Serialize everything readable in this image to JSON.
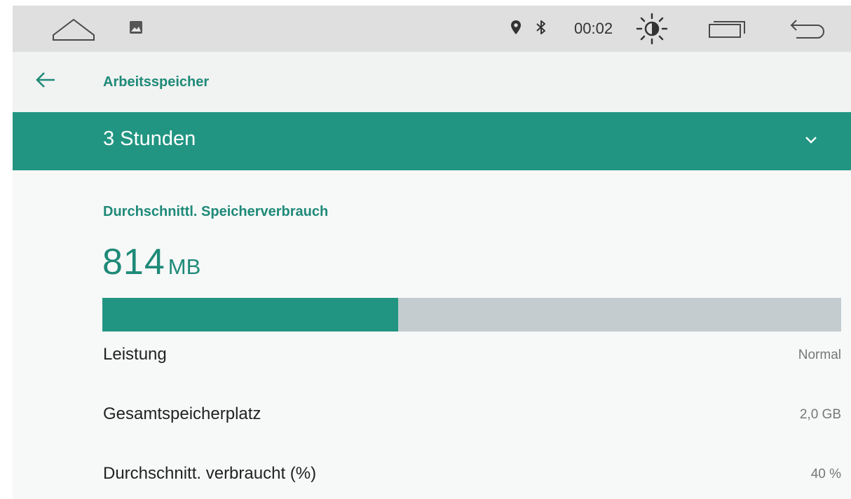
{
  "status_bar": {
    "time": "00:02",
    "icons": [
      "home-icon",
      "gallery-icon",
      "location-icon",
      "bluetooth-icon",
      "brightness-icon",
      "recents-icon",
      "back-icon"
    ]
  },
  "app_bar": {
    "title": "Arbeitsspeicher",
    "back_icon": "arrow-left-icon"
  },
  "period_selector": {
    "selected": "3 Stunden",
    "icon": "chevron-down-icon"
  },
  "memory": {
    "section_title": "Durchschnittl. Speicherverbrauch",
    "usage_value": "814",
    "usage_unit": "MB",
    "usage_fraction": 0.4
  },
  "details": [
    {
      "label": "Leistung",
      "value": "Normal"
    },
    {
      "label": "Gesamtspeicherplatz",
      "value": "2,0 GB"
    },
    {
      "label": "Durchschnitt. verbraucht (%)",
      "value": "40 %"
    }
  ],
  "colors": {
    "accent": "#219582",
    "accent_text": "#1e8a78",
    "bar_track": "#c4ccd0",
    "status_bar": "#dfdfdf"
  }
}
